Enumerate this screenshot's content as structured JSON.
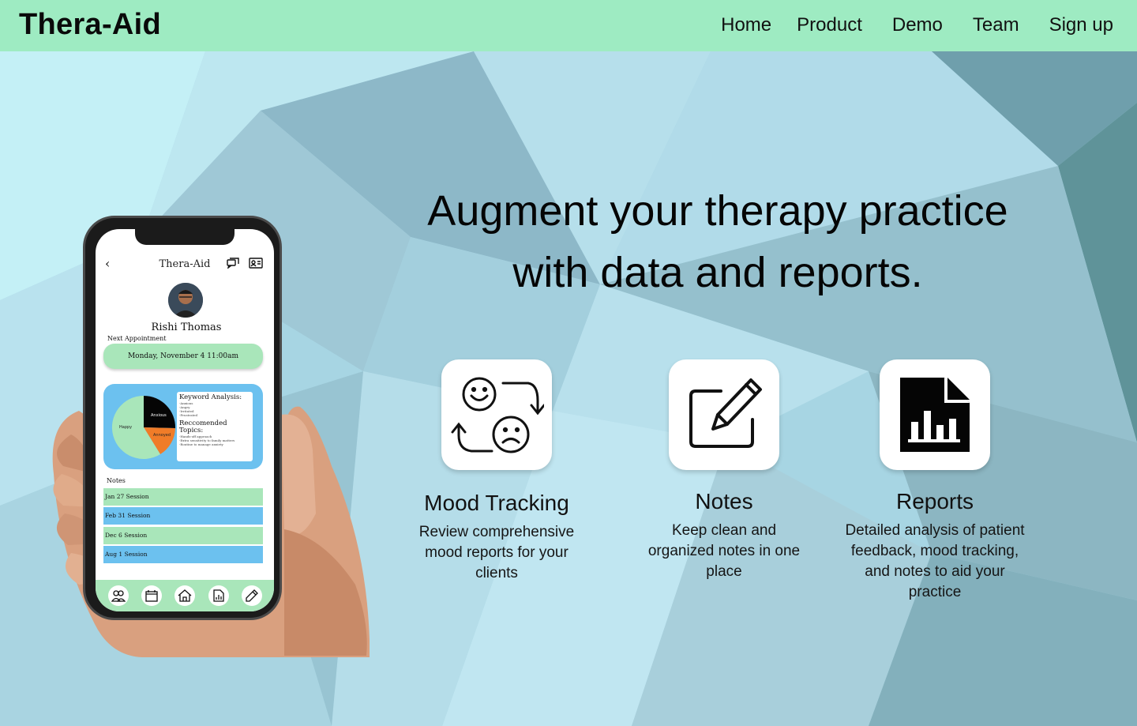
{
  "brand": "Thera-Aid",
  "nav": {
    "home": "Home",
    "product": "Product",
    "demo": "Demo",
    "team": "Team",
    "signup": "Sign up"
  },
  "hero": {
    "headline_line1": "Augment your therapy practice",
    "headline_line2": "with data and reports."
  },
  "features": [
    {
      "title": "Mood Tracking",
      "description": "Review comprehensive mood reports for your clients",
      "icon": "mood-swap-icon"
    },
    {
      "title": "Notes",
      "description": "Keep clean and organized notes in one place",
      "icon": "edit-note-icon"
    },
    {
      "title": "Reports",
      "description": "Detailed analysis of patient feedback, mood tracking, and notes to aid your practice",
      "icon": "report-document-icon"
    }
  ],
  "phone": {
    "app_title": "Thera-Aid",
    "client_name": "Rishi Thomas",
    "next_label": "Next Appointment",
    "appointment": "Monday, November 4 11:00am",
    "keyword_heading": "Keyword Analysis:",
    "keywords": [
      "-Anxious",
      "-Angry",
      "-Irritated",
      "-Frustrated"
    ],
    "topics_heading": "Reccomended Topics:",
    "topics": [
      "-Hands-off approach",
      "-Extra sensitivity to family matters",
      "-Routine to manage anxiety"
    ],
    "pie_labels": {
      "happy": "Happy",
      "anxious": "Anxious",
      "annoyed": "Annoyed"
    },
    "notes_label": "Notes",
    "sessions": [
      "Jan 27 Session",
      "Feb 31 Session",
      "Dec 6 Session",
      "Aug 1 Session"
    ]
  },
  "colors": {
    "nav_bg": "#9eebc2",
    "accent_green": "#a9e6ba",
    "accent_blue": "#6cc1ef"
  }
}
